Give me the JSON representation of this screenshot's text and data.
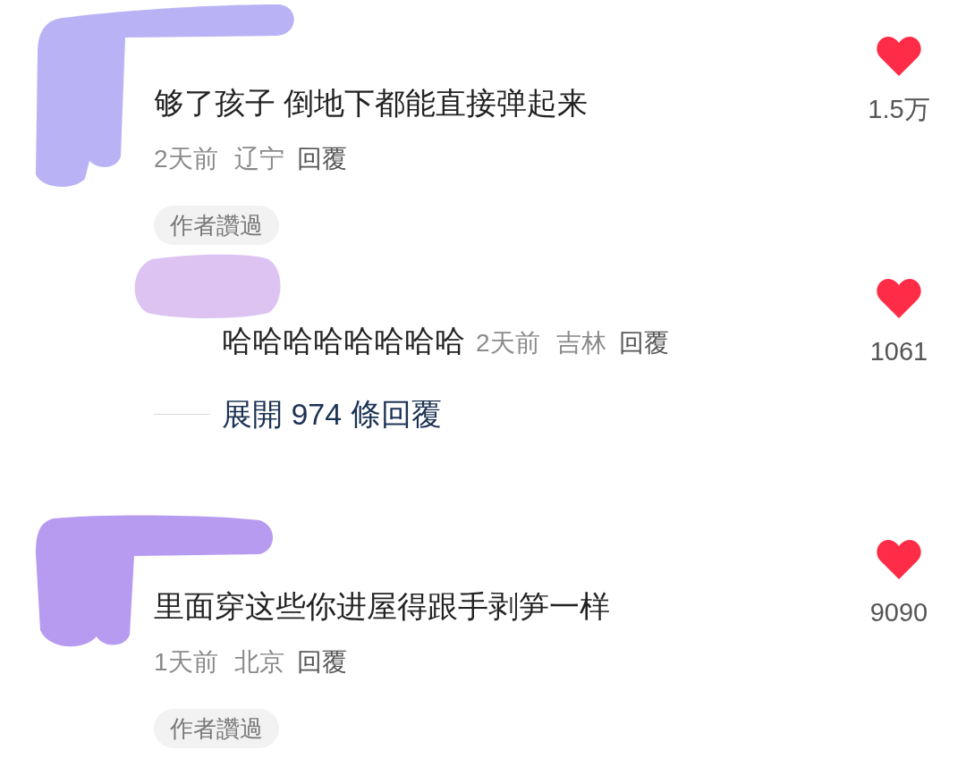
{
  "comments": [
    {
      "text": "够了孩子 倒地下都能直接弹起来",
      "time": "2天前",
      "location": "辽宁",
      "reply": "回覆",
      "likes": "1.5万",
      "liked": true,
      "badge": "作者讚過",
      "replies": [
        {
          "text": "哈哈哈哈哈哈哈哈",
          "time": "2天前",
          "location": "吉林",
          "reply": "回覆",
          "likes": "1061",
          "liked": true
        }
      ],
      "expand": "展開 974 條回覆"
    },
    {
      "text": "里面穿这些你进屋得跟手剥笋一样",
      "time": "1天前",
      "location": "北京",
      "reply": "回覆",
      "likes": "9090",
      "liked": true,
      "badge": "作者讚過"
    }
  ]
}
